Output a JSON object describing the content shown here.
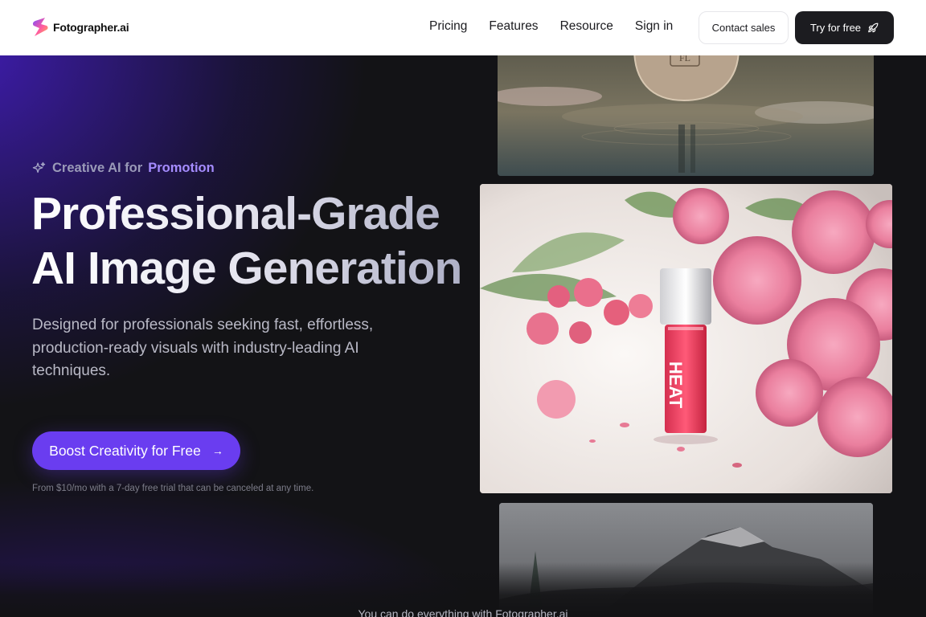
{
  "brand": {
    "name": "Fotographer.ai",
    "logo_colors": [
      "#7a4dff",
      "#ff5aa0",
      "#ffb84d"
    ]
  },
  "nav": {
    "items": [
      {
        "label": "Pricing"
      },
      {
        "label": "Features"
      },
      {
        "label": "Resource"
      },
      {
        "label": "Sign in"
      }
    ]
  },
  "header": {
    "contact_label": "Contact sales",
    "try_label": "Try for free",
    "try_icon": "rocket-icon"
  },
  "hero": {
    "eyebrow_prefix": "Creative AI for",
    "eyebrow_highlight": "Promotion",
    "eyebrow_icon": "sparkle-icon",
    "headline_line1": "Professional-Grade",
    "headline_line2": "AI Image Generation",
    "subtitle": "Designed for professionals seeking fast, effortless, production-ready visuals with industry-leading AI techniques.",
    "cta_label": "Boost Creativity for Free",
    "cta_icon": "arrow-right-icon",
    "fineprint": "From $10/mo with a 7-day free trial that can be canceled at any time."
  },
  "gallery": {
    "images": [
      {
        "subject": "perfume bottle reflected in water",
        "label": "FL"
      },
      {
        "subject": "pink lip gloss among pink peonies",
        "label": "HEAT"
      },
      {
        "subject": "misty mountain landscape"
      }
    ]
  },
  "footer_teaser": "You can do everything with Fotographer.ai",
  "colors": {
    "accent": "#6a3df0",
    "highlight": "#a58cff",
    "background": "#131316",
    "header_bg": "#ffffff"
  }
}
